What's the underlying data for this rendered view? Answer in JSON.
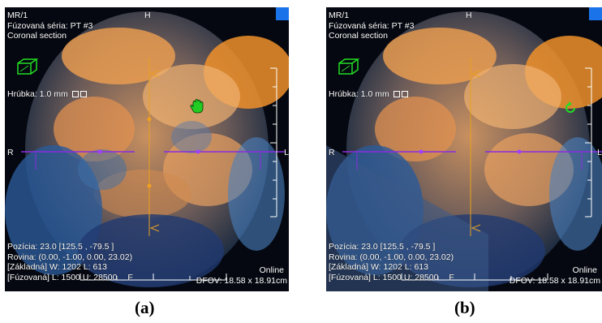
{
  "viewers": [
    {
      "modality": "MR/1",
      "fused_series": "Fúzovaná séria: PT #3",
      "section": "Coronal section",
      "top_marker": "H",
      "left_marker": "R",
      "right_marker": "L",
      "thickness": "Hrúbka: 1.0 mm",
      "position": "Pozícia: 23.0  [125.5 , -79.5 ]",
      "plane": "Rovina: (0.00, -1.00, 0.00, 23.02)",
      "base_wl": "[Základná] W: 1202 L: 613",
      "fused_wl": "[Fúzovaná] L: 1500 U: 28500",
      "foot_marker": "F",
      "status": "Online",
      "dfov": "DFOV: 18.58 x 18.91cm",
      "tool_icon": "hand-pan-icon",
      "caption": "(a)"
    },
    {
      "modality": "MR/1",
      "fused_series": "Fúzovaná séria: PT #3",
      "section": "Coronal section",
      "top_marker": "H",
      "left_marker": "R",
      "right_marker": "L",
      "thickness": "Hrúbka: 1.0 mm",
      "position": "Pozícia: 23.0  [125.5 , -79.5 ]",
      "plane": "Rovina: (0.00, -1.00, 0.00, 23.02)",
      "base_wl": "[Základná] W: 1202 L: 613",
      "fused_wl": "[Fúzovaná] L: 1500 U: 28500",
      "foot_marker": "F",
      "status": "Online",
      "dfov": "DFOV: 18.58 x 18.91cm",
      "tool_icon": "rotate-icon",
      "caption": "(b)"
    }
  ],
  "colors": {
    "crosshair_vertical": "#e8a020",
    "crosshair_horizontal": "#8a2be2",
    "icon_green": "#22dd22",
    "corner_accent": "#1a73e8",
    "pet_orange": "#f0a050",
    "mr_blue": "#3a6ea8"
  }
}
